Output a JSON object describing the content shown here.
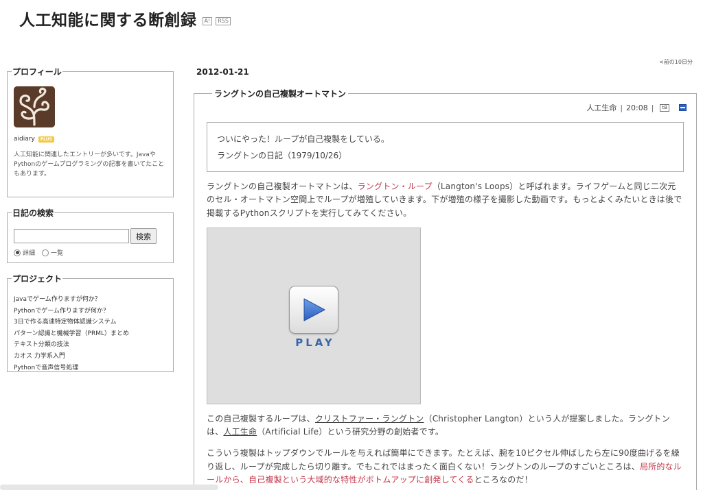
{
  "header": {
    "title": "人工知能に関する断創録",
    "badge_a": "A!",
    "badge_rss": "RSS"
  },
  "sidebar": {
    "profile": {
      "legend": "プロフィール",
      "username": "aidiary",
      "plus": "PLUS",
      "description": "人工知能に関連したエントリーが多いです。JavaやPythonのゲームプログラミングの記事を書いてたこともあります。"
    },
    "search": {
      "legend": "日記の検索",
      "input_value": "",
      "button_label": "検索",
      "options": [
        "詳細",
        "一覧"
      ],
      "selected": "詳細"
    },
    "projects": {
      "legend": "プロジェクト",
      "items": [
        "Javaでゲーム作りますが何か？",
        "Pythonでゲーム作りますが何か？",
        "3日で作る高速特定物体認識システム",
        "パターン認識と機械学習（PRML）まとめ",
        "テキスト分類の技法",
        "カオス 力学系入門",
        "Pythonで音声信号処理"
      ]
    }
  },
  "nav": {
    "prev_link": "<前の10日分"
  },
  "entry": {
    "date": "2012-01-21",
    "title": "ラングトンの自己複製オートマトン",
    "category": "人工生命",
    "time": "20:08",
    "separator": "|",
    "tb_label": "tB",
    "quote_lines": [
      "ついにやった！ループが自己複製をしている。",
      "ラングトンの日記（1979/10/26）"
    ],
    "para1": {
      "a": "ラングトンの自己複製オートマトンは、",
      "link": "ラングトン・ループ",
      "b": "（Langton's Loops）と呼ばれます。ライフゲームと同じ二次元のセル・オートマトン空間上でループが増殖していきます。下が増殖の様子を撮影した動画です。もっとよくみたいときは後で掲載するPythonスクリプトを実行してみてください。"
    },
    "video": {
      "play_label": "PLAY"
    },
    "para2": {
      "a": "この自己複製するループは、",
      "link1": "クリストファー・ラングトン",
      "b": "（Christopher Langton）という人が提案しました。ラングトンは、",
      "link2": "人工生命",
      "c": "（Artificial Life）という研究分野の創始者です。"
    },
    "para3": {
      "a": "こういう複製はトップダウンでルールを与えれば簡単にできます。たとえば、腕を10ピクセル伸ばしたら左に90度曲げるを繰り返し、ループが完成したら切り離す。でもこれではまったく面白くない！ラングトンのループのすごいところは、",
      "highlight": "局所的なルールから、自己複製という大域的な特性がボトムアップに創発してくる",
      "b": "ところなのだ！"
    }
  },
  "colors": {
    "accent_red": "#c4384a",
    "play_blue": "#3a66a8"
  }
}
